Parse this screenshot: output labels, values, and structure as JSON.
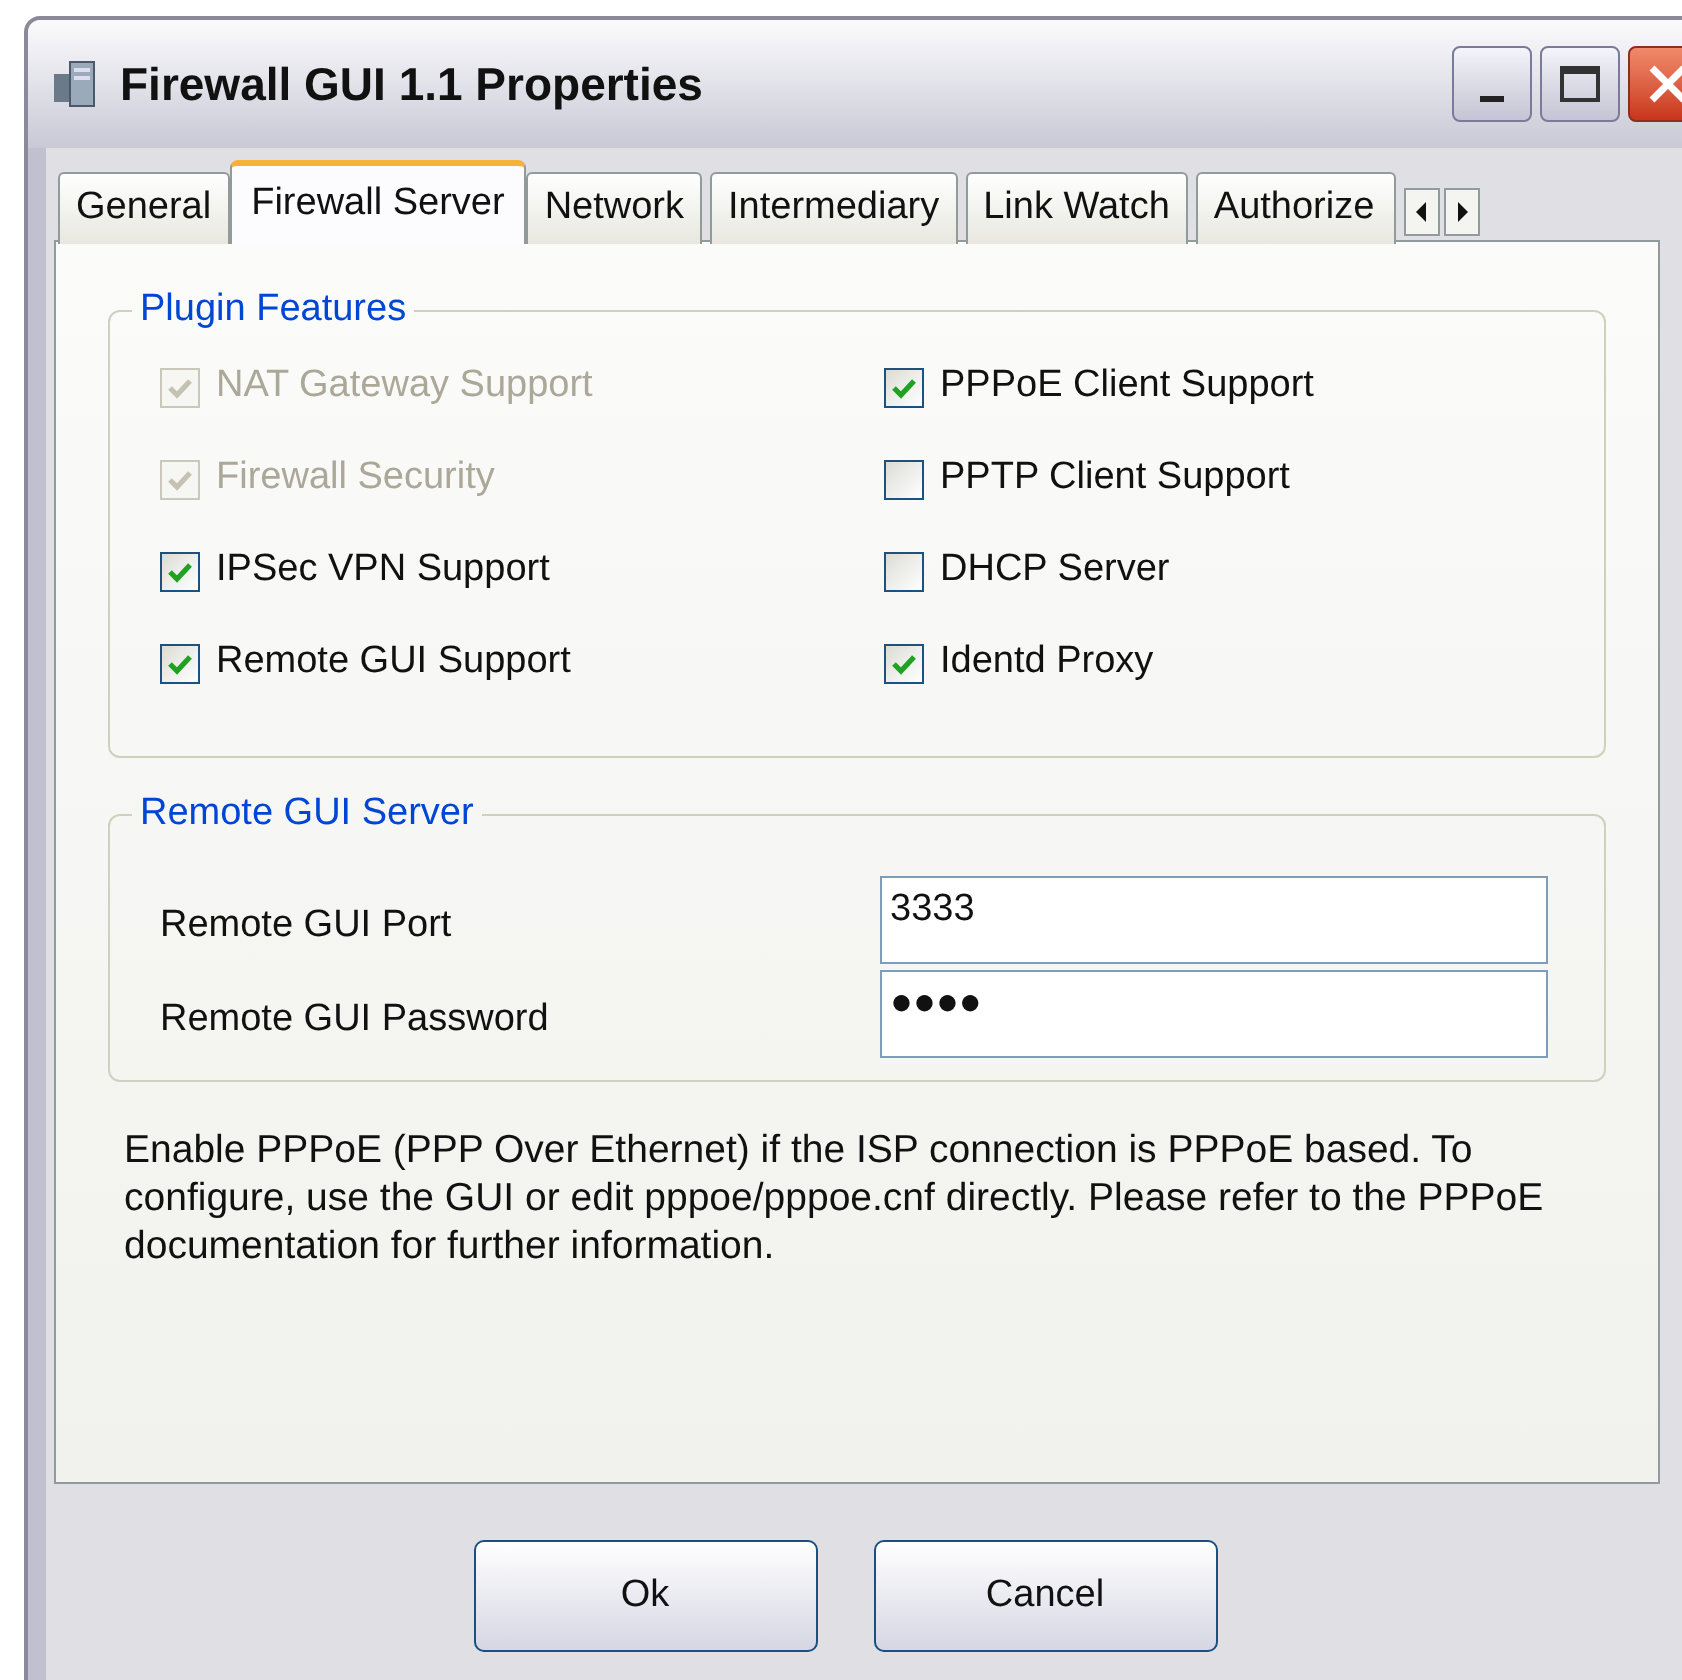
{
  "window": {
    "title": "Firewall GUI 1.1 Properties"
  },
  "tabs": [
    {
      "label": "General",
      "selected": false
    },
    {
      "label": "Firewall Server",
      "selected": true
    },
    {
      "label": "Network",
      "selected": false
    },
    {
      "label": "Intermediary",
      "selected": false
    },
    {
      "label": "Link Watch",
      "selected": false
    },
    {
      "label": "Authorize",
      "selected": false
    }
  ],
  "plugin_features": {
    "title": "Plugin Features",
    "options": [
      {
        "label": "NAT Gateway Support",
        "checked": true,
        "disabled": true
      },
      {
        "label": "PPPoE Client Support",
        "checked": true,
        "disabled": false
      },
      {
        "label": "Firewall Security",
        "checked": true,
        "disabled": true
      },
      {
        "label": "PPTP Client Support",
        "checked": false,
        "disabled": false
      },
      {
        "label": "IPSec VPN Support",
        "checked": true,
        "disabled": false
      },
      {
        "label": "DHCP Server",
        "checked": false,
        "disabled": false
      },
      {
        "label": "Remote GUI Support",
        "checked": true,
        "disabled": false
      },
      {
        "label": "Identd Proxy",
        "checked": true,
        "disabled": false
      }
    ]
  },
  "remote_gui_server": {
    "title": "Remote GUI Server",
    "fields": [
      {
        "label": "Remote GUI Port",
        "value": "3333"
      },
      {
        "label": "Remote GUI Password",
        "value": "●●●●"
      }
    ]
  },
  "description": "Enable PPPoE (PPP Over Ethernet) if the ISP connection is PPPoE based. To configure, use the GUI or edit pppoe/pppoe.cnf directly. Please refer to the PPPoE documentation for further information.",
  "buttons": [
    {
      "label": "Ok"
    },
    {
      "label": "Cancel"
    }
  ]
}
